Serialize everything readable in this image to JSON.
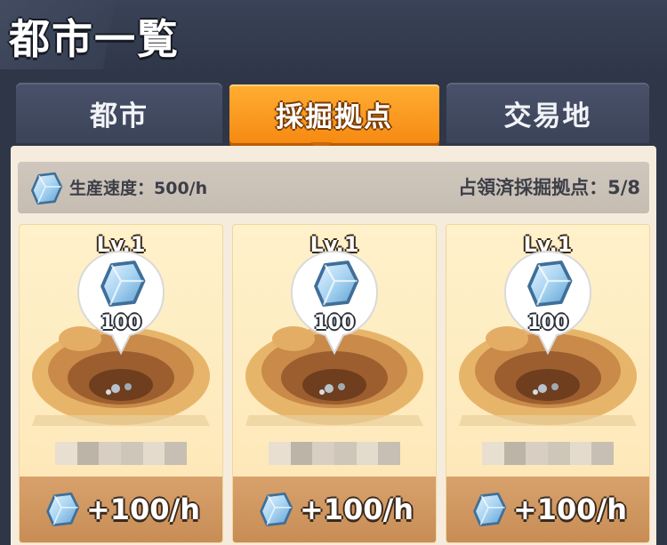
{
  "header": {
    "title": "都市一覧"
  },
  "tabs": [
    {
      "label": "都市",
      "active": false
    },
    {
      "label": "採掘拠点",
      "active": true
    },
    {
      "label": "交易地",
      "active": false
    }
  ],
  "info": {
    "production_rate": "生産速度：500/h",
    "occupied_sites": "占領済採掘拠点：5/8",
    "icon": "crystal-icon"
  },
  "cards": [
    {
      "level": "Lv.1",
      "amount": "100",
      "rate": "+100/h"
    },
    {
      "level": "Lv.1",
      "amount": "100",
      "rate": "+100/h"
    },
    {
      "level": "Lv.1",
      "amount": "100",
      "rate": "+100/h"
    }
  ],
  "colors": {
    "active_tab": "#f68a12",
    "inactive_tab": "#434b61",
    "background": "#2f3647",
    "card": "#fde6b4",
    "rate_bar": "#c88d57"
  }
}
